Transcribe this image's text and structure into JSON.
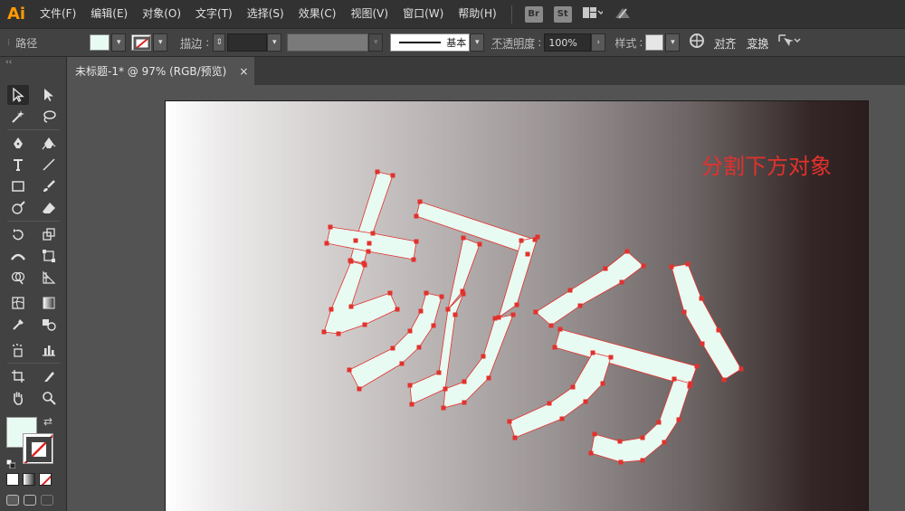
{
  "app": {
    "logo": "Ai"
  },
  "menu": {
    "items": [
      "文件(F)",
      "编辑(E)",
      "对象(O)",
      "文字(T)",
      "选择(S)",
      "效果(C)",
      "视图(V)",
      "窗口(W)",
      "帮助(H)"
    ],
    "bridge_badge": "Br",
    "stock_badge": "St"
  },
  "controlbar": {
    "selection_label": "路径",
    "fill_color": "#e8fbf3",
    "stroke_label": "描边",
    "stroke_style_label": "基本",
    "opacity_label": "不透明度",
    "opacity_value": "100%",
    "style_label": "样式",
    "align_label": "对齐",
    "transform_label": "变换"
  },
  "document": {
    "tab_title": "未标题-1* @ 97% (RGB/预览)",
    "close_symbol": "×"
  },
  "artwork": {
    "annotation": "分割下方对象",
    "annotation_color": "#e3312c",
    "glyph_fill": "#e8fbf3",
    "glyph_outline": "#e3312c",
    "artboard_gradient": [
      "#ffffff",
      "#2b1d1d"
    ]
  },
  "toolbar": {
    "fill_swatch": "#e8fbf3",
    "tools": [
      "selection-tool",
      "direct-selection-tool",
      "magic-wand-tool",
      "lasso-tool",
      "pen-tool",
      "curvature-tool",
      "type-tool",
      "line-tool",
      "rectangle-tool",
      "paintbrush-tool",
      "shaper-tool",
      "eraser-tool",
      "rotate-tool",
      "scale-tool",
      "width-tool",
      "free-transform-tool",
      "shape-builder-tool",
      "perspective-grid-tool",
      "mesh-tool",
      "gradient-tool",
      "eyedropper-tool",
      "blend-tool",
      "symbol-sprayer-tool",
      "column-graph-tool",
      "artboard-tool",
      "slice-tool",
      "hand-tool",
      "zoom-tool"
    ]
  }
}
